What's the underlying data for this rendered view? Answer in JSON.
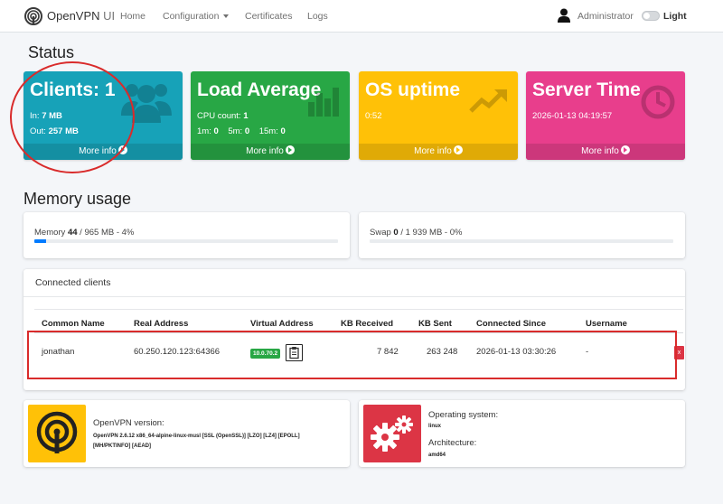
{
  "navbar": {
    "brand_main": "OpenVPN",
    "brand_sub": "UI",
    "links": [
      "Home",
      "Configuration",
      "Certificates",
      "Logs"
    ],
    "user": "Administrator",
    "theme": "Light"
  },
  "status": {
    "heading": "Status",
    "boxes": [
      {
        "title": "Clients: 1",
        "line1_label": "In: ",
        "line1_value": "7 MB",
        "line2_label": "Out: ",
        "line2_value": "257 MB",
        "footer": "More info",
        "color": "#17a2b8",
        "icon": "users-icon"
      },
      {
        "title": "Load Average",
        "line1_label": "CPU count: ",
        "line1_value": "1",
        "line2": {
          "l1": "1m: ",
          "v1": "0",
          "l5": "5m: ",
          "v5": "0",
          "l15": "15m: ",
          "v15": "0"
        },
        "footer": "More info",
        "color": "#28a745",
        "icon": "bar-chart-icon"
      },
      {
        "title": "OS uptime",
        "line1": "0:52",
        "footer": "More info",
        "color": "#ffc107",
        "icon": "trend-up-icon"
      },
      {
        "title": "Server Time",
        "line1": "2026-01-13 04:19:57",
        "footer": "More info",
        "color": "#e83e8c",
        "icon": "clock-icon"
      }
    ]
  },
  "memory": {
    "heading": "Memory usage",
    "memory": {
      "label": "Memory ",
      "used": "44",
      "rest": " / 965 MB - 4%",
      "percent": 4
    },
    "swap": {
      "label": "Swap ",
      "used": "0",
      "rest": " / 1 939 MB - 0%",
      "percent": 0
    }
  },
  "clients": {
    "title": "Connected clients",
    "columns": [
      "Common Name",
      "Real Address",
      "Virtual Address",
      "KB Received",
      "KB Sent",
      "Connected Since",
      "Username"
    ],
    "rows": [
      {
        "common_name": "jonathan",
        "real_address": "60.250.120.123:64366",
        "virtual_address": "10.0.70.2",
        "kb_received": "7 842",
        "kb_sent": "263 248",
        "connected_since": "2026-01-13 03:30:26",
        "username": "-",
        "kill": "x"
      }
    ]
  },
  "version": {
    "label": "OpenVPN version:",
    "value": "OpenVPN 2.6.12 x86_64-alpine-linux-musl [SSL (OpenSSL)] [LZO] [LZ4] [EPOLL] [MH/PKTINFO] [AEAD]"
  },
  "os": {
    "os_label": "Operating system:",
    "os_value": "linux",
    "arch_label": "Architecture:",
    "arch_value": "amd64"
  }
}
